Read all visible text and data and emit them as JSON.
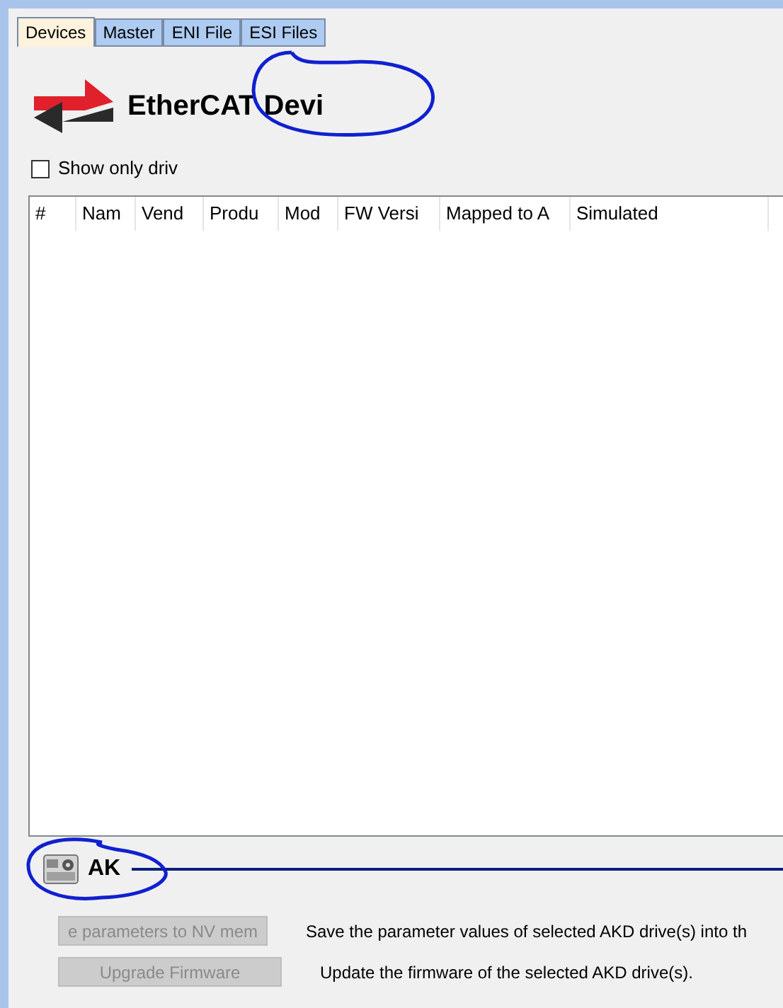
{
  "tabs": [
    {
      "label": "Devices",
      "selected": true
    },
    {
      "label": "Master",
      "selected": false
    },
    {
      "label": "ENI File",
      "selected": false
    },
    {
      "label": "ESI Files",
      "selected": false
    }
  ],
  "heading": "EtherCAT Devi",
  "filter": {
    "label": "Show only driv",
    "checked": false
  },
  "table": {
    "columns": [
      "#",
      "Nam",
      "Vend",
      "Produ",
      "Mod",
      "FW Versi",
      "Mapped to A",
      "Simulated"
    ]
  },
  "section": {
    "title": "AK"
  },
  "actions": [
    {
      "button": "e parameters to NV mem",
      "description": "Save the parameter values of selected AKD drive(s) into th",
      "disabled": true
    },
    {
      "button": "Upgrade Firmware",
      "description": "Update the firmware of the selected AKD drive(s).",
      "disabled": true
    }
  ]
}
